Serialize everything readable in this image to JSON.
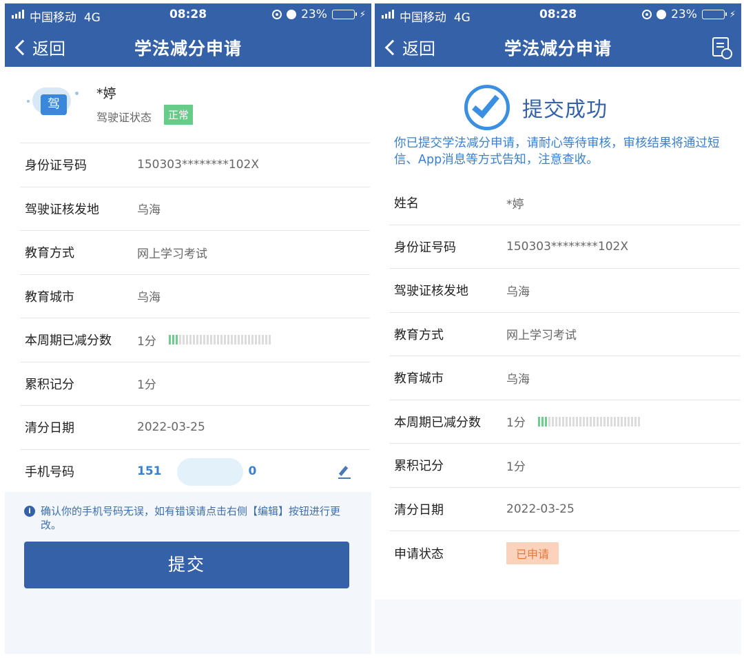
{
  "status_bar": {
    "carrier": "中国移动",
    "network": "4G",
    "time": "08:28",
    "battery": "23%",
    "battery_level": 0.23
  },
  "left": {
    "nav": {
      "back_label": "返回",
      "title": "学法减分申请"
    },
    "license_icon_char": "驾",
    "profile": {
      "name": "*婷",
      "status_label": "驾驶证状态",
      "status_value": "正常"
    },
    "rows": [
      {
        "label": "身份证号码",
        "value": "150303********102X"
      },
      {
        "label": "驾驶证核发地",
        "value": "乌海"
      },
      {
        "label": "教育方式",
        "value": "网上学习考试"
      },
      {
        "label": "教育城市",
        "value": "乌海"
      },
      {
        "label": "本周期已减分数",
        "value": "1分",
        "progress": 0.1
      },
      {
        "label": "累积记分",
        "value": "1分"
      },
      {
        "label": "清分日期",
        "value": "2022-03-25"
      },
      {
        "label": "手机号码",
        "value": "151",
        "value_suffix": "0"
      }
    ],
    "tip": "确认你的手机号码无误，如有错误请点击右侧【编辑】按钮进行更改。",
    "submit_label": "提交"
  },
  "right": {
    "nav": {
      "back_label": "返回",
      "title": "学法减分申请"
    },
    "success_title": "提交成功",
    "success_desc": "你已提交学法减分申请，请耐心等待审核，审核结果将通过短信、App消息等方式告知，注意查收。",
    "rows": [
      {
        "label": "姓名",
        "value": "*婷"
      },
      {
        "label": "身份证号码",
        "value": "150303********102X"
      },
      {
        "label": "驾驶证核发地",
        "value": "乌海"
      },
      {
        "label": "教育方式",
        "value": "网上学习考试"
      },
      {
        "label": "教育城市",
        "value": "乌海"
      },
      {
        "label": "本周期已减分数",
        "value": "1分",
        "progress": 0.1
      },
      {
        "label": "累积记分",
        "value": "1分"
      },
      {
        "label": "清分日期",
        "value": "2022-03-25"
      },
      {
        "label": "申请状态",
        "value": "已申请"
      }
    ]
  },
  "colors": {
    "primary": "#3561a9",
    "accent_blue": "#3a7fd0",
    "success_green": "#66cc88",
    "applied_orange": "#e8773a"
  }
}
